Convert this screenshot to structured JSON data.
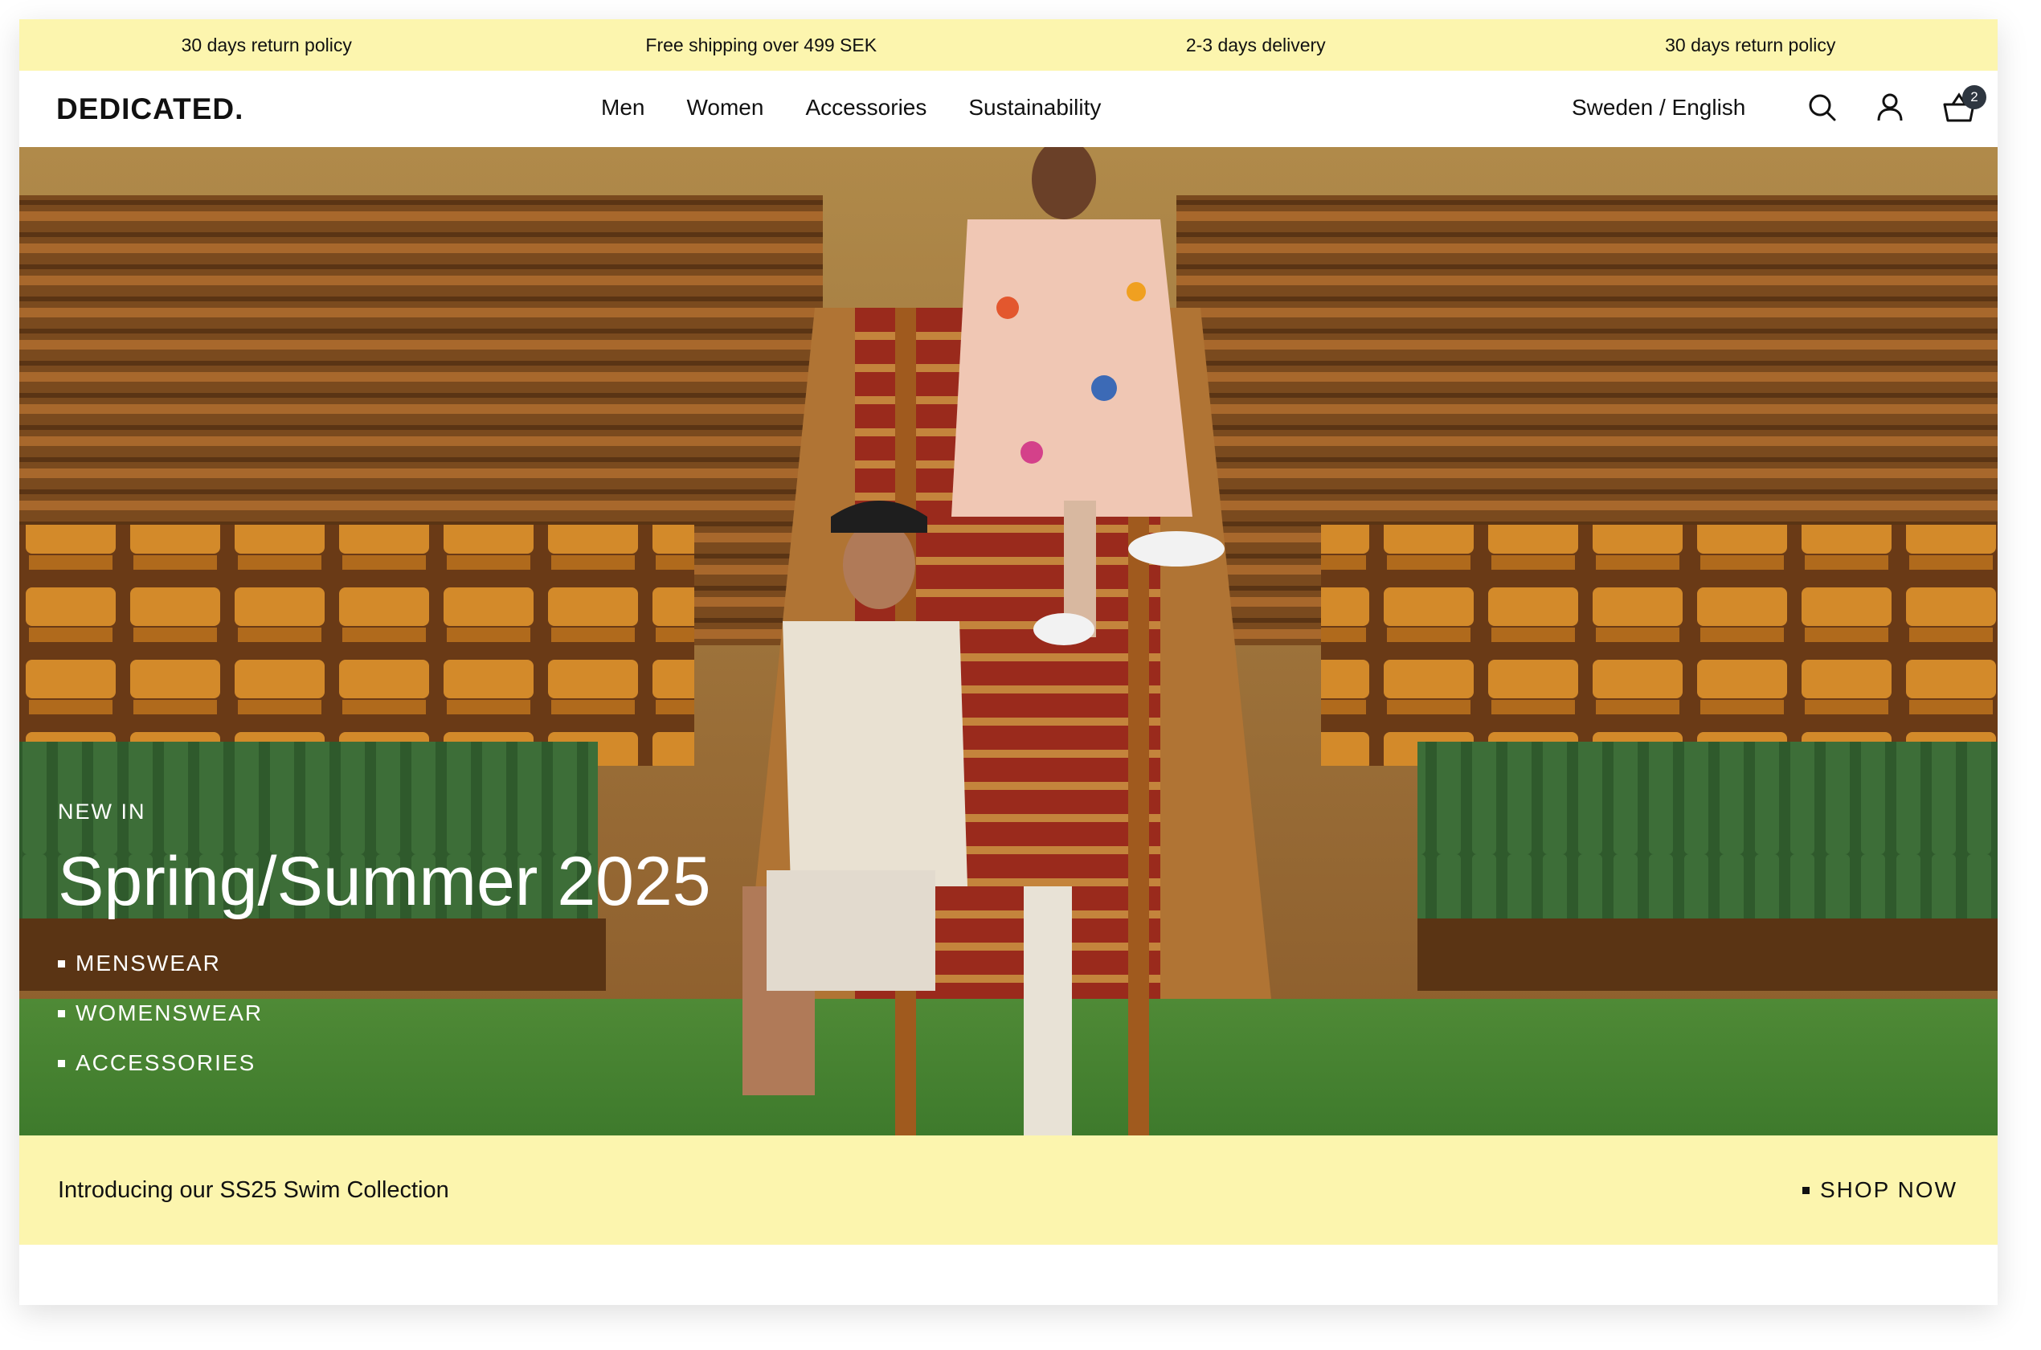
{
  "announcement": {
    "items": [
      "30 days return policy",
      "Free shipping over 499 SEK",
      "2-3 days delivery",
      "30 days return policy"
    ]
  },
  "header": {
    "logo": "DEDICATED.",
    "nav": [
      "Men",
      "Women",
      "Accessories",
      "Sustainability"
    ],
    "locale": "Sweden / English",
    "cart_count": "2",
    "icons": [
      "search-icon",
      "account-icon",
      "cart-icon"
    ]
  },
  "hero": {
    "eyebrow": "NEW IN",
    "headline": "Spring/Summer 2025",
    "links": [
      "MENSWEAR",
      "WOMENSWEAR",
      "ACCESSORIES"
    ]
  },
  "promo": {
    "text": "Introducing our SS25 Swim Collection",
    "cta": "SHOP NOW"
  },
  "colors": {
    "announcement_bg": "#fcf5ae",
    "text": "#111111",
    "badge": "#2e3640"
  }
}
